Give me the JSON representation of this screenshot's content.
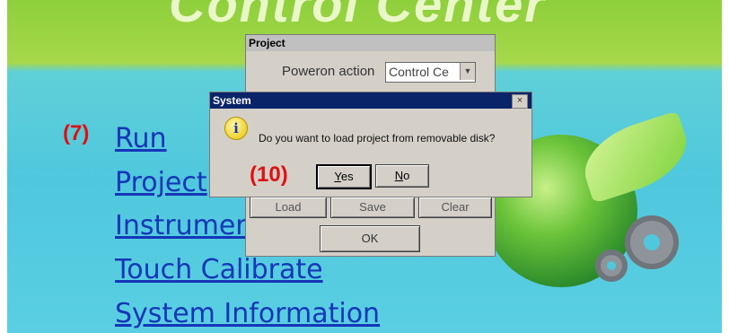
{
  "banner": {
    "title": "Control Center"
  },
  "menu": {
    "run": "Run",
    "project": "Project",
    "instrument": "Instrumer",
    "touch": "Touch Calibrate",
    "sysinfo": "System Information"
  },
  "annotations": {
    "left": "(7)",
    "dialog": "(10)"
  },
  "project_dialog": {
    "title": "Project",
    "poweron_label": "Poweron action",
    "poweron_value": "Control Ce",
    "load": "Load",
    "save": "Save",
    "clear": "Clear",
    "ok": "OK"
  },
  "system_dialog": {
    "title": "System",
    "close_glyph": "×",
    "info_glyph": "i",
    "message": "Do you want to load project from removable disk?",
    "yes": "Yes",
    "no": "No"
  },
  "icons": [
    "info-icon",
    "close-icon",
    "chevron-down-icon",
    "globe-logo",
    "gear-icon"
  ],
  "colors": {
    "link": "#1536b8",
    "annotation": "#e01010",
    "titlebar": "#0a246a"
  }
}
